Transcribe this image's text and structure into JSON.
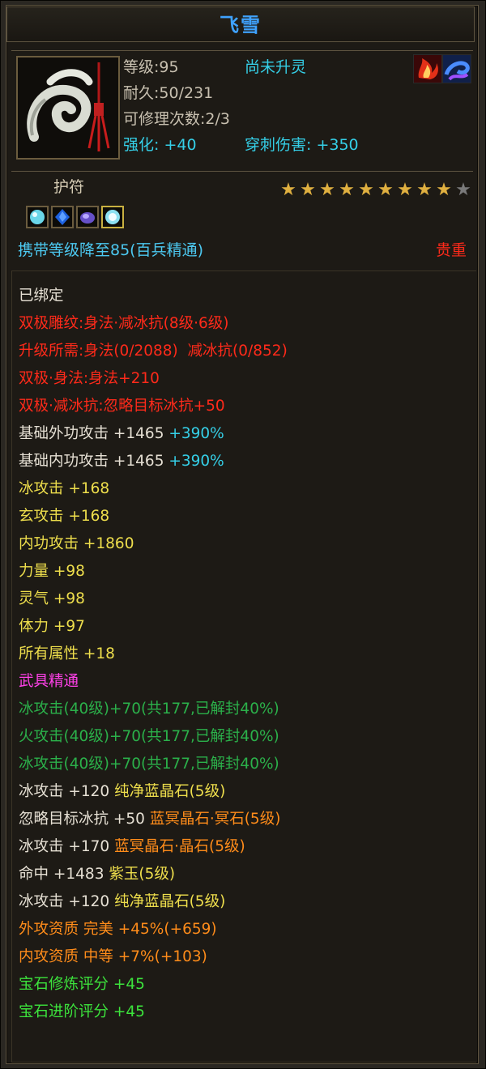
{
  "title": "飞雪",
  "header": {
    "level": "等级:95",
    "spirit_status": "尚未升灵",
    "durability": "耐久:50/231",
    "repair_count": "可修理次数:2/3",
    "enhance_label": "强化:",
    "enhance_value": "+40",
    "pierce_label": "穿刺伤害:",
    "pierce_value": "+350",
    "icons": [
      "item-talisman-icon",
      "flame-status-icon",
      "swirl-status-icon"
    ]
  },
  "talisman": {
    "label": "护符",
    "stars_filled": 9,
    "stars_total": 10,
    "gem_slots": [
      "cyan-gem-icon",
      "blue-gem-icon",
      "purple-gem-icon",
      "crystal-gem-icon"
    ],
    "carry_text": "携带等级降至85(百兵精通)",
    "rarity": "贵重"
  },
  "colors": {
    "title": "#3fa2ff",
    "red": "#ff2a1a",
    "cyan": "#35d0e8",
    "yellow": "#eede4c",
    "magenta": "#ff40e8",
    "green": "#2bb04a",
    "orange": "#ff8c1a",
    "bright_green": "#3ce33c"
  },
  "attributes": {
    "bound": "已绑定",
    "double_engrave": "双极雕纹:身法·减冰抗(8级·6级)",
    "upgrade_req_a": "升级所需:身法(0/2088)",
    "upgrade_req_b": "减冰抗(0/852)",
    "double_agility": "双极·身法:身法+210",
    "double_ice": "双极·减冰抗:忽略目标冰抗+50",
    "base_ext_label": "基础外功攻击 +1465",
    "base_ext_pct": "+390%",
    "base_int_label": "基础内功攻击 +1465",
    "base_int_pct": "+390%",
    "ice_attack": "冰攻击 +168",
    "xuan_attack": "玄攻击 +168",
    "int_attack": "内功攻击 +1860",
    "strength": "力量 +98",
    "spirit": "灵气 +98",
    "stamina": "体力 +97",
    "all_attr": "所有属性 +18",
    "mastery_title": "武具精通",
    "mastery_1": "冰攻击(40级)+70(共177,已解封40%)",
    "mastery_2": "火攻击(40级)+70(共177,已解封40%)",
    "mastery_3": "冰攻击(40级)+70(共177,已解封40%)",
    "gem1_stat": "冰攻击 +120",
    "gem1_name": "纯净蓝晶石(5级)",
    "gem2_stat": "忽略目标冰抗 +50",
    "gem2_name": "蓝冥晶石·冥石(5级)",
    "gem3_stat": "冰攻击 +170",
    "gem3_name": "蓝冥晶石·晶石(5级)",
    "gem4_stat": "命中 +1483",
    "gem4_name": "紫玉(5级)",
    "gem5_stat": "冰攻击 +120",
    "gem5_name": "纯净蓝晶石(5级)",
    "ext_quality": "外攻资质  完美 +45%(+659)",
    "int_quality": "内攻资质  中等 +7%(+103)",
    "gem_refine_score": "宝石修炼评分 +45",
    "gem_advance_score": "宝石进阶评分 +45"
  }
}
